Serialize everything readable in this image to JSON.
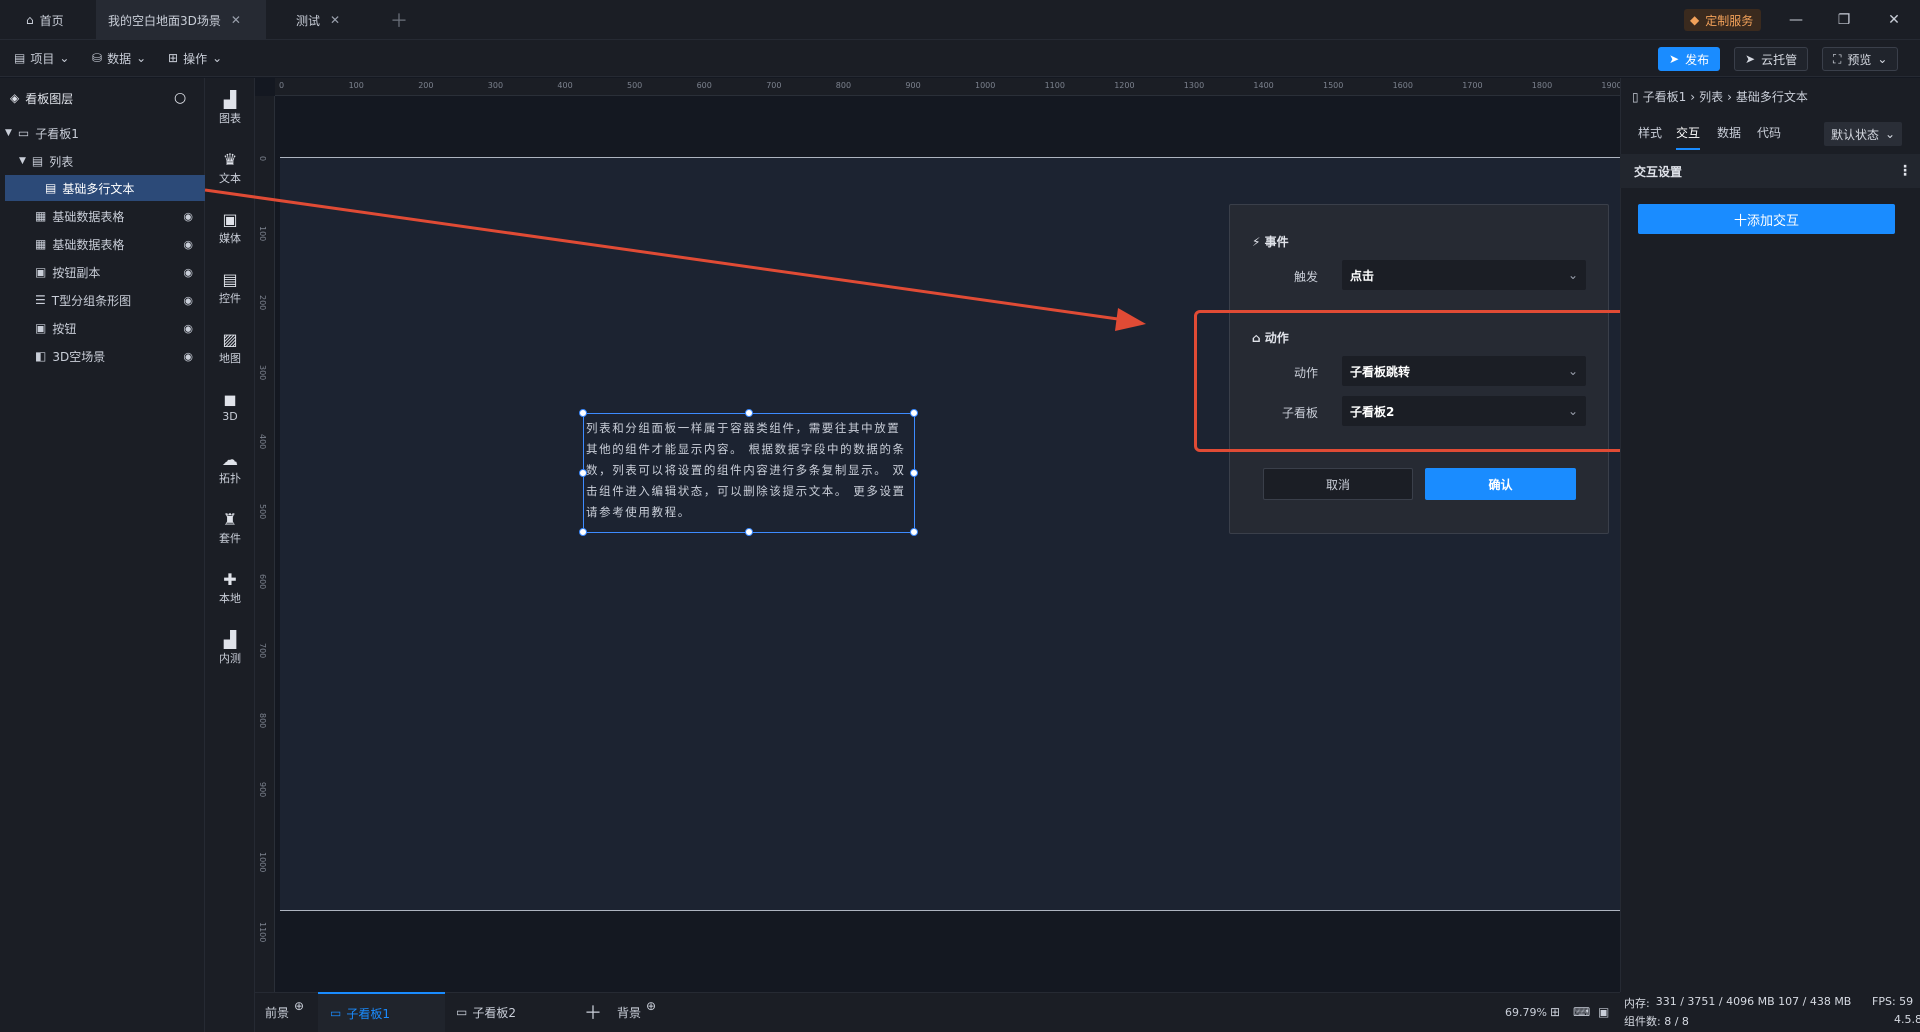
{
  "titlebar": {
    "tabs": [
      {
        "label": "首页"
      },
      {
        "label": "我的空白地面3D场景"
      },
      {
        "label": "测试"
      }
    ],
    "custom_service": "定制服务"
  },
  "toolbar": {
    "menus": [
      "项目",
      "数据",
      "操作"
    ],
    "publish": "发布",
    "cloud": "云托管",
    "preview": "预览"
  },
  "layers": {
    "title": "看板图层",
    "items": [
      {
        "label": "子看板1"
      },
      {
        "label": "列表"
      },
      {
        "label": "基础多行文本"
      },
      {
        "label": "基础数据表格"
      },
      {
        "label": "基础数据表格"
      },
      {
        "label": "按钮副本"
      },
      {
        "label": "T型分组条形图"
      },
      {
        "label": "按钮"
      },
      {
        "label": "3D空场景"
      }
    ]
  },
  "rail": [
    "图表",
    "文本",
    "媒体",
    "控件",
    "地图",
    "3D",
    "拓扑",
    "套件",
    "本地",
    "内测"
  ],
  "ruler": {
    "top": [
      "0",
      "100",
      "200",
      "300",
      "400",
      "500",
      "600",
      "700",
      "800",
      "900",
      "1000",
      "1100",
      "1200",
      "1300",
      "1400",
      "1500",
      "1600",
      "1700",
      "1800",
      "1900"
    ],
    "left": [
      "0",
      "100",
      "200",
      "300",
      "400",
      "500",
      "600",
      "700",
      "800",
      "900",
      "1000",
      "1100"
    ]
  },
  "canvas": {
    "text_component": "列表和分组面板一样属于容器类组件，需要往其中放置其他的组件才能显示内容。 根据数据字段中的数据的条数，列表可以将设置的组件内容进行多条复制显示。 双击组件进入编辑状态，可以删除该提示文本。 更多设置请参考使用教程。"
  },
  "dialog": {
    "event_section": "事件",
    "trigger_label": "触发",
    "trigger_value": "点击",
    "action_section": "动作",
    "action_label": "动作",
    "action_value": "子看板跳转",
    "subboard_label": "子看板",
    "subboard_value": "子看板2",
    "cancel": "取消",
    "confirm": "确认"
  },
  "rightpanel": {
    "breadcrumb": [
      "子看板1",
      "列表",
      "基础多行文本"
    ],
    "tabs": [
      "样式",
      "交互",
      "数据",
      "代码"
    ],
    "state": "默认状态",
    "section": "交互设置",
    "add_button": "十添加交互"
  },
  "bottombar": {
    "tabs": [
      "前景",
      "子看板1",
      "子看板2",
      "背景"
    ],
    "zoom": "69.79%"
  },
  "status": {
    "memory_label": "内存:",
    "memory_value": "331 / 3751 / 4096 MB  107 / 438 MB",
    "fps": "FPS:  59",
    "components": "组件数: 8 / 8",
    "version": "4.5.8"
  },
  "colors": {
    "accent": "#1a8cff",
    "highlight": "#e04b35",
    "canvas": "#1c2331"
  }
}
